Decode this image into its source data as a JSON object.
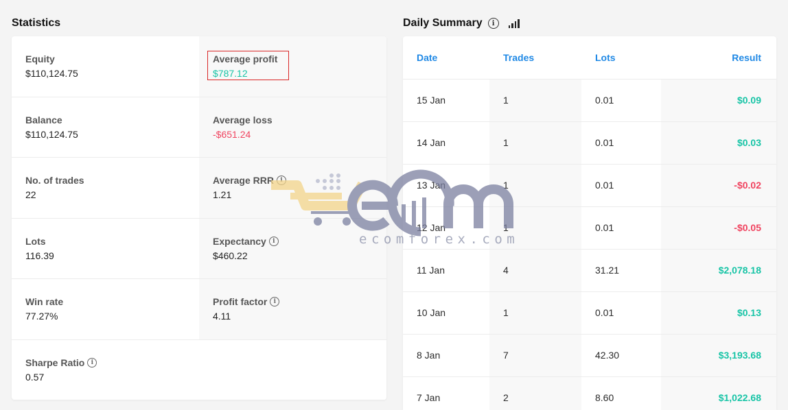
{
  "statistics": {
    "title": "Statistics",
    "rows": [
      {
        "left": {
          "label": "Equity",
          "value": "$110,124.75"
        },
        "right": {
          "label": "Average profit",
          "value": "$787.12",
          "tone": "green"
        }
      },
      {
        "left": {
          "label": "Balance",
          "value": "$110,124.75"
        },
        "right": {
          "label": "Average loss",
          "value": "-$651.24",
          "tone": "red"
        }
      },
      {
        "left": {
          "label": "No. of trades",
          "value": "22"
        },
        "right": {
          "label": "Average RRR",
          "value": "1.21",
          "info": true
        }
      },
      {
        "left": {
          "label": "Lots",
          "value": "116.39"
        },
        "right": {
          "label": "Expectancy",
          "value": "$460.22",
          "info": true
        }
      },
      {
        "left": {
          "label": "Win rate",
          "value": "77.27%"
        },
        "right": {
          "label": "Profit factor",
          "value": "4.11",
          "info": true
        }
      },
      {
        "left": {
          "label": "Sharpe Ratio",
          "value": "0.57",
          "info": true
        }
      }
    ]
  },
  "daily_summary": {
    "title": "Daily Summary",
    "columns": [
      "Date",
      "Trades",
      "Lots",
      "Result"
    ],
    "rows": [
      {
        "date": "15 Jan",
        "trades": "1",
        "lots": "0.01",
        "result": "$0.09",
        "tone": "green"
      },
      {
        "date": "14 Jan",
        "trades": "1",
        "lots": "0.01",
        "result": "$0.03",
        "tone": "green"
      },
      {
        "date": "13 Jan",
        "trades": "1",
        "lots": "0.01",
        "result": "-$0.02",
        "tone": "red"
      },
      {
        "date": "12 Jan",
        "trades": "1",
        "lots": "0.01",
        "result": "-$0.05",
        "tone": "red"
      },
      {
        "date": "11 Jan",
        "trades": "4",
        "lots": "31.21",
        "result": "$2,078.18",
        "tone": "green"
      },
      {
        "date": "10 Jan",
        "trades": "1",
        "lots": "0.01",
        "result": "$0.13",
        "tone": "green"
      },
      {
        "date": "8 Jan",
        "trades": "7",
        "lots": "42.30",
        "result": "$3,193.68",
        "tone": "green"
      },
      {
        "date": "7 Jan",
        "trades": "2",
        "lots": "8.60",
        "result": "$1,022.68",
        "tone": "green"
      }
    ]
  },
  "icons": {
    "info": "info-icon",
    "chart": "bar-chart-icon"
  },
  "colors": {
    "accent": "#1e88e5",
    "positive": "#17c4a6",
    "negative": "#f0435f",
    "highlight": "#d92626"
  },
  "watermark": {
    "text": "ecomforex.com"
  }
}
